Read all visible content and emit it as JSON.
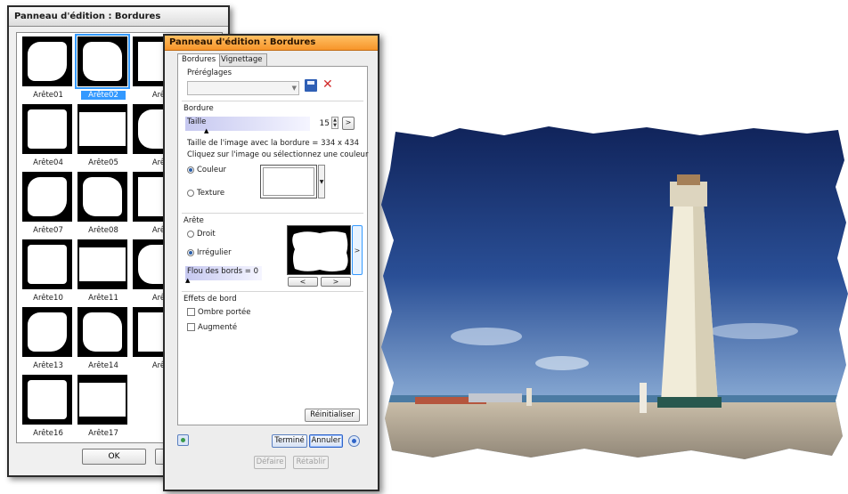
{
  "back_window": {
    "title": "Panneau d'édition : Bordures",
    "thumbnails": [
      "Arête01",
      "Arête02",
      "Arê",
      "Arête04",
      "Arête05",
      "Arê",
      "Arête07",
      "Arête08",
      "Arê",
      "Arête10",
      "Arête11",
      "Arê",
      "Arête13",
      "Arête14",
      "Arê",
      "Arête16",
      "Arête17"
    ],
    "selected": "Arête02",
    "ok_label": "OK"
  },
  "front_window": {
    "title": "Panneau d'édition : Bordures",
    "tabs": [
      "Bordures",
      "Vignettage"
    ],
    "presets_label": "Préréglages",
    "border_section": "Bordure",
    "size_label": "Taille",
    "size_value": "15",
    "size_fraction": 0.15,
    "image_size_text": "Taille de l'image avec la bordure = 334 x 434",
    "click_hint": "Cliquez sur l'image ou sélectionnez une couleur",
    "color_option": "Couleur",
    "texture_option": "Texture",
    "edge_section": "Arête",
    "straight_option": "Droit",
    "irregular_option": "Irrégulier",
    "blur_label": "Flou des bords = 0",
    "effects_section": "Effets de bord",
    "drop_shadow": "Ombre portée",
    "enhance": "Augmenté",
    "reset_label": "Réinitialiser",
    "done_label": "Terminé",
    "cancel_label": "Annuler",
    "undo_label": "Défaire",
    "redo_label": "Rétablir",
    "arrow_next": ">",
    "arrow_prev": "<"
  },
  "colors": {
    "title_orange": "#f7952a",
    "selection_blue": "#3399ff",
    "sky": "#1c3a78"
  }
}
